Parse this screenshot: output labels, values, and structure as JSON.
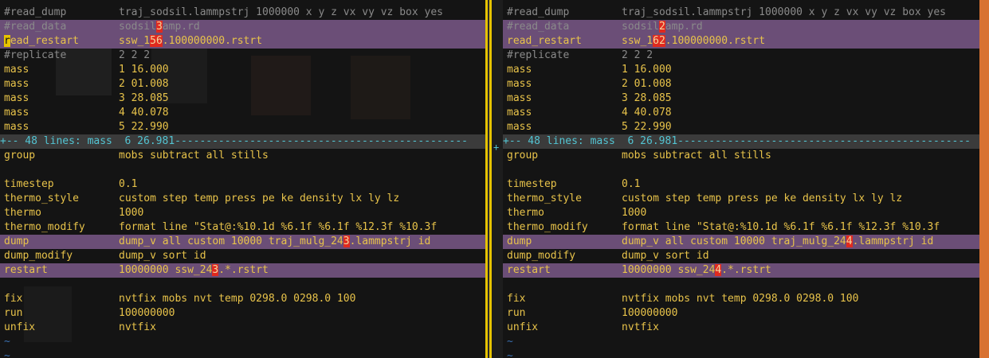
{
  "left": {
    "lines": [
      {
        "t": "cmt",
        "k": "#read_dump",
        "v": [
          [
            "traj_sodsil.lammpstrj 1000000 x y z vx vy vz box yes",
            ""
          ]
        ]
      },
      {
        "t": "diff cmt",
        "k": "#read_data",
        "v": [
          [
            "sodsil",
            ""
          ],
          [
            "3",
            "red"
          ],
          [
            "amp.rd",
            ""
          ]
        ]
      },
      {
        "t": "diff",
        "k": [
          [
            "r",
            "ycur"
          ],
          [
            "ead_restart",
            ""
          ]
        ],
        "v": [
          [
            "ssw_1",
            ""
          ],
          [
            "56",
            "red"
          ],
          [
            ".100000000.rstrt",
            ""
          ]
        ]
      },
      {
        "t": "cmt",
        "k": "#replicate",
        "v": [
          [
            "2 2 2",
            ""
          ]
        ]
      },
      {
        "t": "",
        "k": "mass",
        "v": [
          [
            "1 16.000",
            ""
          ]
        ]
      },
      {
        "t": "",
        "k": "mass",
        "v": [
          [
            "2 01.008",
            ""
          ]
        ]
      },
      {
        "t": "",
        "k": "mass",
        "v": [
          [
            "3 28.085",
            ""
          ]
        ]
      },
      {
        "t": "",
        "k": "mass",
        "v": [
          [
            "4 40.078",
            ""
          ]
        ]
      },
      {
        "t": "",
        "k": "mass",
        "v": [
          [
            "5 22.990",
            ""
          ]
        ]
      },
      {
        "t": "fold",
        "k": "+-- 48 lines: mass  6 26.981-----------------------------------------------",
        "v": []
      },
      {
        "t": "",
        "k": "group",
        "v": [
          [
            "mobs subtract all stills",
            ""
          ]
        ]
      },
      {
        "t": "",
        "k": "",
        "v": []
      },
      {
        "t": "",
        "k": "timestep",
        "v": [
          [
            "0.1",
            ""
          ]
        ]
      },
      {
        "t": "",
        "k": "thermo_style",
        "v": [
          [
            "custom step temp press pe ke density lx ly lz",
            ""
          ]
        ]
      },
      {
        "t": "",
        "k": "thermo",
        "v": [
          [
            "1000",
            ""
          ]
        ]
      },
      {
        "t": "",
        "k": "thermo_modify",
        "v": [
          [
            "format line \"Stat@:%10.1d %6.1f %6.1f %12.3f %10.3f",
            ""
          ]
        ]
      },
      {
        "t": "diff",
        "k": "dump",
        "v": [
          [
            "dump_v all custom 10000 traj_mulg_24",
            ""
          ],
          [
            "3",
            "red"
          ],
          [
            ".lammpstrj id",
            ""
          ]
        ]
      },
      {
        "t": "",
        "k": "dump_modify",
        "v": [
          [
            "dump_v sort id",
            ""
          ]
        ]
      },
      {
        "t": "diff",
        "k": "restart",
        "v": [
          [
            "10000000 ssw_24",
            ""
          ],
          [
            "3",
            "red"
          ],
          [
            ".*.rstrt",
            ""
          ]
        ]
      },
      {
        "t": "",
        "k": "",
        "v": []
      },
      {
        "t": "",
        "k": "fix",
        "v": [
          [
            "nvtfix mobs nvt temp 0298.0 0298.0 100",
            ""
          ]
        ]
      },
      {
        "t": "",
        "k": "run",
        "v": [
          [
            "100000000",
            ""
          ]
        ]
      },
      {
        "t": "",
        "k": "unfix",
        "v": [
          [
            "nvtfix",
            ""
          ]
        ]
      },
      {
        "t": "tilde",
        "k": "~",
        "v": []
      },
      {
        "t": "tilde",
        "k": "~",
        "v": []
      }
    ]
  },
  "right": {
    "lines": [
      {
        "t": "cmt",
        "k": "#read_dump",
        "v": [
          [
            "traj_sodsil.lammpstrj 1000000 x y z vx vy vz box yes",
            ""
          ]
        ]
      },
      {
        "t": "diff cmt",
        "k": "#read_data",
        "v": [
          [
            "sodsil",
            ""
          ],
          [
            "2",
            "red"
          ],
          [
            "amp.rd",
            ""
          ]
        ]
      },
      {
        "t": "diff",
        "k": "read_restart",
        "v": [
          [
            "ssw_1",
            ""
          ],
          [
            "62",
            "red"
          ],
          [
            ".100000000.rstrt",
            ""
          ]
        ]
      },
      {
        "t": "cmt",
        "k": "#replicate",
        "v": [
          [
            "2 2 2",
            ""
          ]
        ]
      },
      {
        "t": "",
        "k": "mass",
        "v": [
          [
            "1 16.000",
            ""
          ]
        ]
      },
      {
        "t": "",
        "k": "mass",
        "v": [
          [
            "2 01.008",
            ""
          ]
        ]
      },
      {
        "t": "",
        "k": "mass",
        "v": [
          [
            "3 28.085",
            ""
          ]
        ]
      },
      {
        "t": "",
        "k": "mass",
        "v": [
          [
            "4 40.078",
            ""
          ]
        ]
      },
      {
        "t": "",
        "k": "mass",
        "v": [
          [
            "5 22.990",
            ""
          ]
        ]
      },
      {
        "t": "fold",
        "k": "+-- 48 lines: mass  6 26.981-----------------------------------------------",
        "v": []
      },
      {
        "t": "",
        "k": "group",
        "v": [
          [
            "mobs subtract all stills",
            ""
          ]
        ]
      },
      {
        "t": "",
        "k": "",
        "v": []
      },
      {
        "t": "",
        "k": "timestep",
        "v": [
          [
            "0.1",
            ""
          ]
        ]
      },
      {
        "t": "",
        "k": "thermo_style",
        "v": [
          [
            "custom step temp press pe ke density lx ly lz",
            ""
          ]
        ]
      },
      {
        "t": "",
        "k": "thermo",
        "v": [
          [
            "1000",
            ""
          ]
        ]
      },
      {
        "t": "",
        "k": "thermo_modify",
        "v": [
          [
            "format line \"Stat@:%10.1d %6.1f %6.1f %12.3f %10.3f",
            ""
          ]
        ]
      },
      {
        "t": "diff",
        "k": "dump",
        "v": [
          [
            "dump_v all custom 10000 traj_mulg_24",
            ""
          ],
          [
            "4",
            "red"
          ],
          [
            ".lammpstrj id",
            ""
          ]
        ]
      },
      {
        "t": "",
        "k": "dump_modify",
        "v": [
          [
            "dump_v sort id",
            ""
          ]
        ]
      },
      {
        "t": "diff",
        "k": "restart",
        "v": [
          [
            "10000000 ssw_24",
            ""
          ],
          [
            "4",
            "red"
          ],
          [
            ".*.rstrt",
            ""
          ]
        ]
      },
      {
        "t": "",
        "k": "",
        "v": []
      },
      {
        "t": "",
        "k": "fix",
        "v": [
          [
            "nvtfix mobs nvt temp 0298.0 0298.0 100",
            ""
          ]
        ]
      },
      {
        "t": "",
        "k": "run",
        "v": [
          [
            "100000000",
            ""
          ]
        ]
      },
      {
        "t": "",
        "k": "unfix",
        "v": [
          [
            "nvtfix",
            ""
          ]
        ]
      },
      {
        "t": "tilde",
        "k": "~",
        "v": []
      },
      {
        "t": "tilde",
        "k": "~",
        "v": []
      }
    ]
  },
  "gutter_fold_marker": "+",
  "colors": {
    "text": "#e8c34a",
    "comment": "#8a8a8a",
    "diff_bg": "#6b4e77",
    "change_bg": "#e02a1f",
    "fold_text": "#53c4d2",
    "separator": "#e6c300",
    "right_bar": "#d87232"
  }
}
